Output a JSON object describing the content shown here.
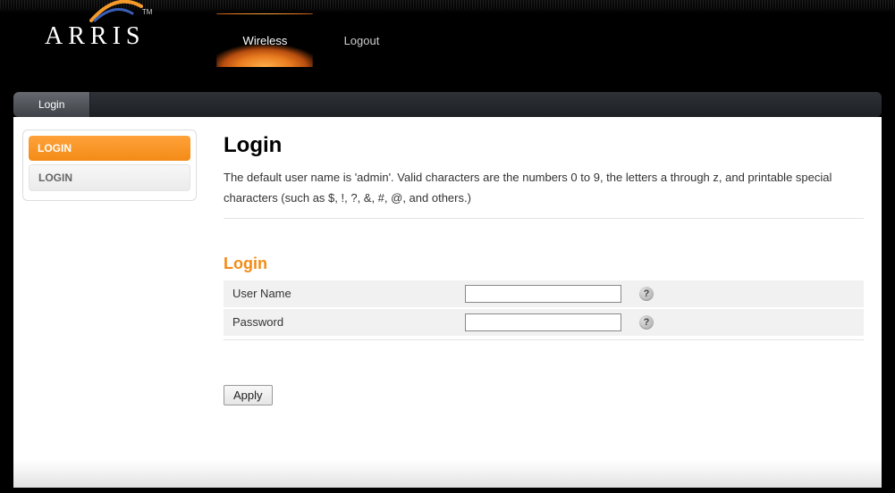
{
  "brand": {
    "name": "ARRIS",
    "tm": "TM"
  },
  "tabs": {
    "wireless": "Wireless",
    "logout": "Logout"
  },
  "subtab": {
    "login": "Login"
  },
  "sidebar": {
    "items": [
      {
        "label": "LOGIN"
      },
      {
        "label": "LOGIN"
      }
    ]
  },
  "page": {
    "title": "Login",
    "description": "The default user name is 'admin'. Valid characters are the numbers 0 to 9, the letters a through z, and printable special characters (such as $, !, ?, &, #, @, and others.)"
  },
  "form": {
    "section_title": "Login",
    "username_label": "User Name",
    "username_value": "",
    "password_label": "Password",
    "password_value": "",
    "help_glyph": "?",
    "apply_label": "Apply"
  }
}
